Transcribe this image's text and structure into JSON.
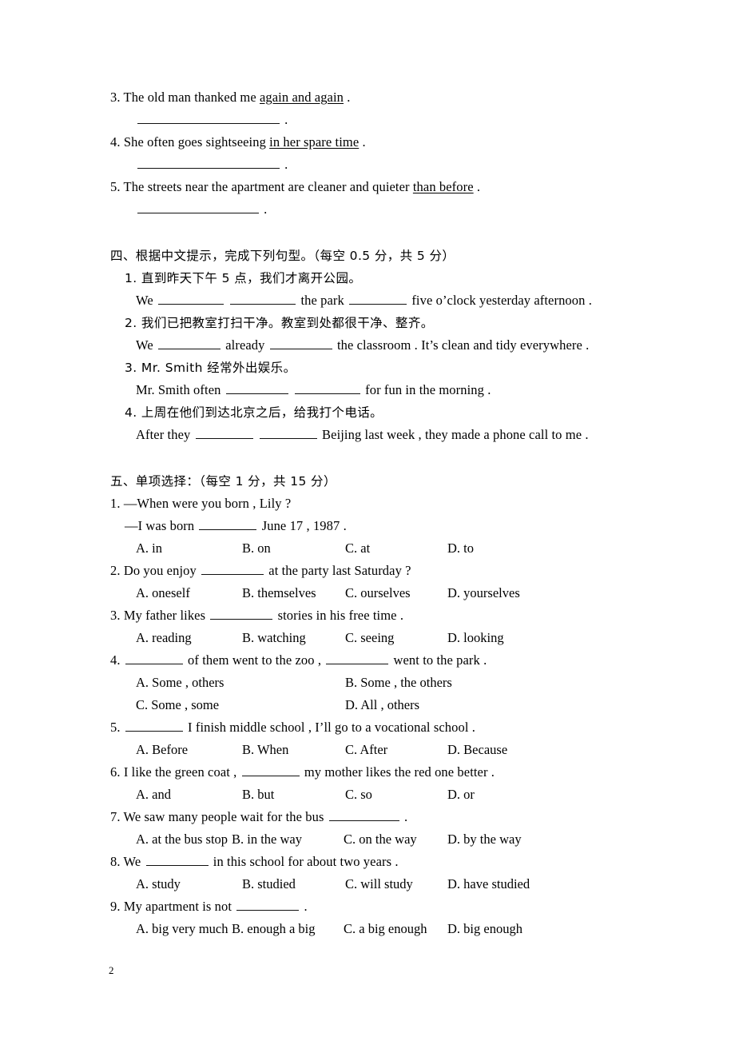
{
  "document": {
    "page_number": "2"
  },
  "section_three_tail": {
    "items": [
      {
        "number": "3.",
        "sentence_before": "The old man thanked me ",
        "underlined": "again and again",
        "sentence_after": " ."
      },
      {
        "number": "4.",
        "sentence_before": "She often goes sightseeing ",
        "underlined": "in her spare time",
        "sentence_after": " ."
      },
      {
        "number": "5.",
        "sentence_before": "The streets near the apartment are cleaner and quieter ",
        "underlined": "than before",
        "sentence_after": " ."
      }
    ],
    "answer_period": "."
  },
  "section_four": {
    "heading": "四、根据中文提示，完成下列句型。（每空 0.5 分，共 5 分）",
    "items": [
      {
        "number": "1.",
        "chinese": "直到昨天下午 5 点，我们才离开公园。",
        "english_parts": [
          "We ",
          " ",
          " the park ",
          " five o’clock yesterday afternoon ."
        ]
      },
      {
        "number": "2.",
        "chinese": "我们已把教室打扫干净。教室到处都很干净、整齐。",
        "english_parts": [
          "We ",
          " already ",
          " the classroom . It’s clean and tidy everywhere ."
        ]
      },
      {
        "number": "3.",
        "chinese": "Mr. Smith 经常外出娱乐。",
        "english_parts": [
          "Mr. Smith often ",
          " ",
          " for fun in the morning ."
        ]
      },
      {
        "number": "4.",
        "chinese": "上周在他们到达北京之后，给我打个电话。",
        "english_parts": [
          "After they ",
          " ",
          " Beijing last week , they made a phone call to me ."
        ]
      }
    ]
  },
  "section_five": {
    "heading": "五、单项选择：（每空 1 分，共 15 分）",
    "questions": [
      {
        "number": "1.",
        "stem_line1": "—When were you born , Lily ?",
        "stem_line2_before": "—I was born ",
        "stem_line2_after": " June 17 , 1987 .",
        "layout": "default",
        "options": [
          "A. in",
          "B. on",
          "C. at",
          "D. to"
        ]
      },
      {
        "number": "2.",
        "stem_before": "Do you enjoy ",
        "stem_after": " at the party last Saturday ?",
        "layout": "default",
        "options": [
          "A. oneself",
          "B. themselves",
          "C. ourselves",
          "D. yourselves"
        ]
      },
      {
        "number": "3.",
        "stem_before": "My father likes ",
        "stem_after": " stories in his free time .",
        "layout": "default",
        "options": [
          "A. reading",
          "B. watching",
          "C. seeing",
          "D. looking"
        ]
      },
      {
        "number": "4.",
        "stem_before": "",
        "stem_middle": " of them went to the zoo , ",
        "stem_after": " went to the park .",
        "layout": "two-column",
        "options": [
          "A. Some , others",
          "B. Some , the others",
          "C. Some , some",
          "D. All , others"
        ]
      },
      {
        "number": "5.",
        "stem_before": "",
        "stem_after": " I finish middle school , I’ll go to a vocational school .",
        "layout": "default",
        "options": [
          "A. Before",
          "B. When",
          "C. After",
          "D. Because"
        ]
      },
      {
        "number": "6.",
        "stem_before": "I like the green coat , ",
        "stem_after": " my mother likes the red one better .",
        "layout": "default",
        "options": [
          "A. and",
          "B. but",
          "C. so",
          "D. or"
        ]
      },
      {
        "number": "7.",
        "stem_before": "We saw many people wait for the bus ",
        "stem_after": " .",
        "layout": "wide",
        "options": [
          "A. at the bus stop",
          "B. in the way",
          "C. on the way",
          "D. by the way"
        ]
      },
      {
        "number": "8.",
        "stem_before": "We ",
        "stem_after": " in this school for about two years .",
        "layout": "default",
        "options": [
          "A. study",
          "B. studied",
          "C. will study",
          "D. have studied"
        ]
      },
      {
        "number": "9.",
        "stem_before": "My apartment is not ",
        "stem_after": " .",
        "layout": "wide",
        "options": [
          "A. big very much",
          "B. enough a big",
          "C. a big enough",
          "D. big enough"
        ]
      }
    ]
  }
}
